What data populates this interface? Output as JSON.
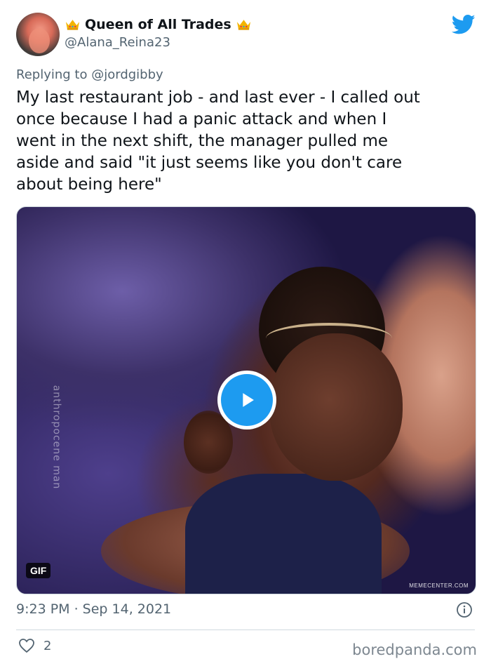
{
  "header": {
    "display_name": "Queen of All Trades",
    "handle": "@Alana_Reina23"
  },
  "tweet": {
    "replying_prefix": "Replying to",
    "replying_to": "@jordgibby",
    "text": "My last restaurant job - and last ever - I called out\nonce because I had a panic attack and when I\nwent in the next shift, the manager pulled me\naside and said \"it just seems like you don't care\nabout being here\""
  },
  "media": {
    "badge": "GIF",
    "side_watermark": "anthropocene man",
    "corner_watermark": "MEMECENTER.COM"
  },
  "footer": {
    "timestamp": "9:23 PM · Sep 14, 2021",
    "like_count": "2",
    "source": "boredpanda.com"
  },
  "icons": {
    "twitter": "twitter-bird-icon",
    "crown": "crown-emoji-icon",
    "play": "play-icon",
    "info": "info-icon",
    "heart": "heart-icon"
  },
  "colors": {
    "accent": "#1d9bf0",
    "text": "#0f1419",
    "muted": "#536471",
    "crown": "#f4b400"
  }
}
